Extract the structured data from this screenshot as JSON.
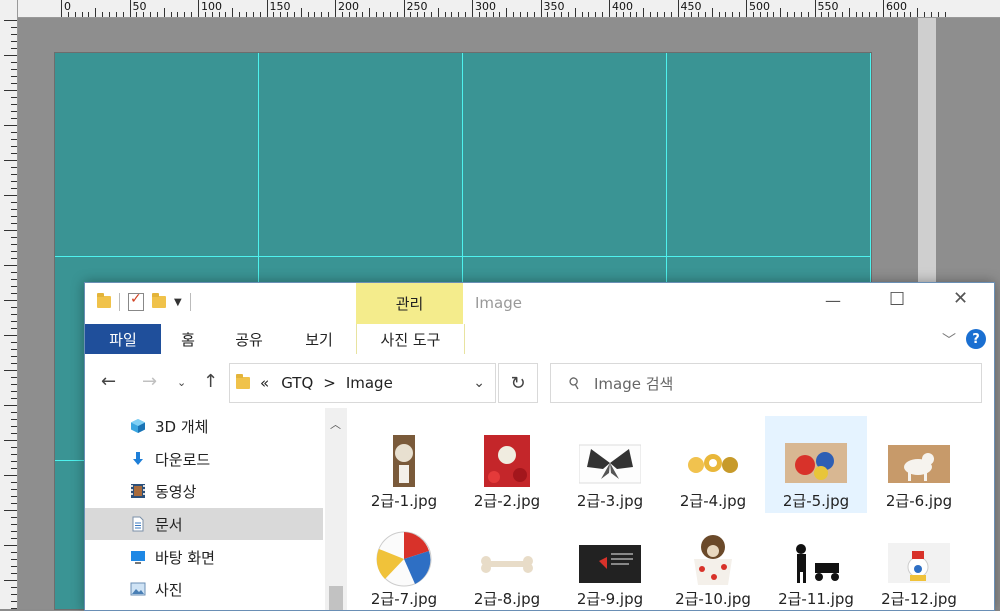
{
  "ruler": {
    "labels": [
      "0",
      "50",
      "100",
      "150",
      "200",
      "250",
      "300",
      "350",
      "400",
      "450",
      "500",
      "550",
      "600"
    ]
  },
  "explorer": {
    "title": "Image",
    "manage_tab": "관리",
    "ribbon_tabs": {
      "file": "파일",
      "home": "홈",
      "share": "공유",
      "view": "보기",
      "photo_tools": "사진 도구"
    },
    "help": "?",
    "address": {
      "chevrons": "«",
      "crumb1": "GTQ",
      "sep": ">",
      "crumb2": "Image"
    },
    "search_placeholder": "Image 검색",
    "sidebar": [
      {
        "label": "3D 개체",
        "icon": "cube-icon"
      },
      {
        "label": "다운로드",
        "icon": "download-icon"
      },
      {
        "label": "동영상",
        "icon": "video-icon"
      },
      {
        "label": "문서",
        "icon": "document-icon",
        "selected": true
      },
      {
        "label": "바탕 화면",
        "icon": "desktop-icon"
      },
      {
        "label": "사진",
        "icon": "pictures-icon"
      }
    ],
    "files": [
      "2급-1.jpg",
      "2급-2.jpg",
      "2급-3.jpg",
      "2급-4.jpg",
      "2급-5.jpg",
      "2급-6.jpg",
      "2급-7.jpg",
      "2급-8.jpg",
      "2급-9.jpg",
      "2급-10.jpg",
      "2급-11.jpg",
      "2급-12.jpg"
    ],
    "hovered_file": "2급-5.jpg"
  },
  "colors": {
    "canvas": "#3a9494",
    "guide": "#4ef2ee",
    "file_tab": "#1f4f9b",
    "manage_tab": "#f4ec8c"
  }
}
